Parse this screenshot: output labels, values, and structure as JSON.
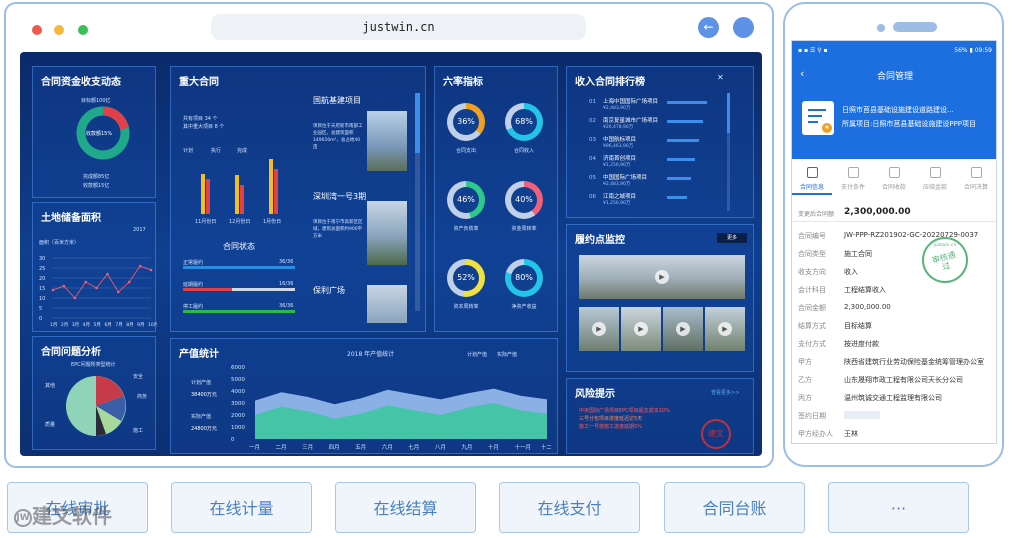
{
  "browser": {
    "url": "justwin.cn",
    "back_icon": "←"
  },
  "dashboard": {
    "fund_panel": {
      "title": "合同资金收支动态",
      "top": "目标额100亿",
      "center": "收款额15%",
      "bottom1": "完成额85亿",
      "bottom2": "收款额15亿"
    },
    "land_panel": {
      "title": "土地储备面积",
      "legend": "2017",
      "ylabel": "面积（百米方米）",
      "yticks": [
        "30",
        "25",
        "20",
        "15",
        "10",
        "5",
        "0"
      ],
      "xticks": [
        "1月",
        "2月",
        "3月",
        "4月",
        "5月",
        "6月",
        "7月",
        "8月",
        "9月",
        "10月"
      ],
      "values": [
        14,
        16,
        10,
        18,
        15,
        22,
        13,
        18,
        26,
        24
      ]
    },
    "issue_panel": {
      "title": "合同问题分析",
      "subtitle": "EPC问题所类型统计",
      "labels": [
        "其他",
        "质量",
        "安全",
        "商务",
        "施工"
      ]
    },
    "major_panel": {
      "title": "重大合同",
      "line1": "共有项目 34 个",
      "line2": "其中重大项目 8 个",
      "legend": [
        "计划",
        "执行",
        "完成"
      ],
      "bars_xticks": [
        "11月份日",
        "12月份日",
        "1月份日"
      ],
      "status_title": "合同状态",
      "status": [
        {
          "label": "正常履约",
          "value": "36/36"
        },
        {
          "label": "延期履约",
          "value": "16/36"
        },
        {
          "label": "停工履约",
          "value": "36/36"
        }
      ],
      "projects": [
        {
          "name": "国航基建项目",
          "desc": "项目位于天府新市南部工业园区，总建筑面积149650m²，总占地40亩"
        },
        {
          "name": "深圳湾一号3期",
          "desc": "项目位于南宁市高新区区域，建筑总面积约900平方米"
        },
        {
          "name": "保利广场",
          "desc": ""
        }
      ]
    },
    "rate_panel": {
      "title": "六率指标",
      "rings": [
        {
          "value": "36%",
          "label": "合同支出",
          "color": "#f0a020"
        },
        {
          "value": "68%",
          "label": "合同收入",
          "color": "#23c4e6"
        },
        {
          "value": "46%",
          "label": "资产负债率",
          "color": "#2dc98a"
        },
        {
          "value": "40%",
          "label": "资金周转率",
          "color": "#f0607a"
        },
        {
          "value": "52%",
          "label": "资本周转率",
          "color": "#f0e040"
        },
        {
          "value": "80%",
          "label": "净资产收益",
          "color": "#23c4e6"
        }
      ]
    },
    "rank_panel": {
      "title": "收入合同排行榜",
      "items": [
        {
          "no": "01",
          "name": "上海中国国际广场项目",
          "amount": "¥2,483,90万"
        },
        {
          "no": "02",
          "name": "南京复星城市广场项目",
          "amount": "¥26,478,90万"
        },
        {
          "no": "03",
          "name": "中国航标项目",
          "amount": "¥96,463,90万"
        },
        {
          "no": "04",
          "name": "济南首创项目",
          "amount": "¥1,256,90万"
        },
        {
          "no": "05",
          "name": "中国国际广场项目",
          "amount": "¥2,483,90万"
        },
        {
          "no": "06",
          "name": "江南之城项目",
          "amount": "¥1,256,90万"
        }
      ]
    },
    "monitor_panel": {
      "title": "履约点监控",
      "button": "更多"
    },
    "risk_panel": {
      "title": "风险提示",
      "more": "查看更多>>",
      "items": [
        "中央国际广场项目EPC项目超支成本20%",
        "三号分包项目进度延迟达5天",
        "施工一号楼施工进度延期5%"
      ],
      "stamp": "建文"
    },
    "output_panel": {
      "title": "产值统计",
      "chart_title": "2018 年产值统计",
      "legend": [
        "计划产值",
        "实际产值"
      ],
      "plan_label": "计划产值",
      "plan_value": "38400万元",
      "actual_label": "实际产值",
      "actual_value": "24800万元",
      "yticks": [
        "6000",
        "5000",
        "4000",
        "3000",
        "2000",
        "1000",
        "0"
      ],
      "xticks": [
        "一月",
        "二月",
        "三月",
        "四月",
        "五月",
        "六月",
        "七月",
        "八月",
        "九月",
        "十月",
        "十一月",
        "十二月"
      ]
    }
  },
  "phone": {
    "status_left": "▪ ▪ ☰ ⚲ ▪",
    "status_right": "56% ▮ 09:59",
    "header": "合同管理",
    "project1": "日照市莒县基础设施建设道路建设...",
    "project2": "所属项目:日照市莒县基础设施建设PPP项目",
    "tabs": [
      "合同信息",
      "支付条件",
      "合同收款",
      "应结金款",
      "合同决算"
    ],
    "amount_label": "变更后合同额",
    "amount": "2,300,000.00",
    "rows": [
      {
        "k": "合同编号",
        "v": "JW-PPP-RZ201902-GC-20220729-0037"
      },
      {
        "k": "合同类型",
        "v": "施工合同"
      },
      {
        "k": "收支方向",
        "v": "收入"
      },
      {
        "k": "会计科目",
        "v": "工程结算收入"
      },
      {
        "k": "合同金额",
        "v": "2,300,000.00"
      },
      {
        "k": "结算方式",
        "v": "目标结算"
      },
      {
        "k": "支付方式",
        "v": "按进度付款"
      },
      {
        "k": "甲方",
        "v": "陕西省建筑行业劳动保险基金统筹管理办公室"
      },
      {
        "k": "乙方",
        "v": "山东晟翔市政工程有限公司天长分公司"
      },
      {
        "k": "丙方",
        "v": "温州筑诚交通工程监理有限公司"
      },
      {
        "k": "签约日期",
        "v": ""
      },
      {
        "k": "甲方经办人",
        "v": "王林"
      }
    ],
    "stamp_top": "justwin.cn",
    "stamp_main": "审核通过"
  },
  "tiles": [
    "在线审批",
    "在线计量",
    "在线结算",
    "在线支付",
    "合同台账",
    "···"
  ],
  "watermark": "建文软件"
}
